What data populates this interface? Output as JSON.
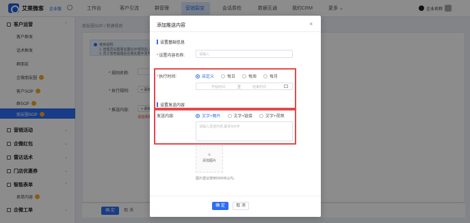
{
  "app": {
    "brand": "艾莱微客",
    "brand_sub": "企业版",
    "user_name": "企业名称"
  },
  "nav": [
    "工作台",
    "客户引流",
    "群管理",
    "营销裂变",
    "会话质检",
    "数据互通",
    "我的CRM",
    "更多 ⌄"
  ],
  "nav_active_index": 3,
  "sidebar": {
    "groups": [
      {
        "label": "客户运营",
        "items": [
          "客户群发",
          "话术群发",
          "群朋友",
          "企微朋友圈",
          "客户SOP",
          "群SOP",
          "朋友圈SOP"
        ]
      },
      {
        "label": "营销活动"
      },
      {
        "label": "企微红包"
      },
      {
        "label": "雷达话术"
      },
      {
        "label": "门店优惠券"
      },
      {
        "label": "智能表单",
        "items": [
          "表单内容"
        ]
      },
      {
        "label": "企微工单"
      }
    ],
    "active_item": "朋友圈SOP"
  },
  "main": {
    "breadcrumb": "朋友圈SOP / 新建规则",
    "tip_title": "使用说明:",
    "tip_lines": [
      "1. 管理员设置朋友圈SOP规则后,员工会收到推送提醒",
      "2. 员工收到提醒后在朋友圈中发布内容"
    ],
    "rule_name_label": "* 规则名称:",
    "rule_name_placeholder": "请输入",
    "exec_rule_label": "* 执行规则:",
    "add_label": "+ 添加",
    "push_content_label": "* 推送内容:",
    "push_add_label": "+ 添加",
    "red_hint": "请选择执行规则",
    "confirm": "确 定",
    "cancel": "取 消"
  },
  "modal": {
    "title": "添加推送内容",
    "close": "×",
    "section1": "设置基础信息",
    "content_name_label": "设置内容名称:",
    "content_name_placeholder": "请输入",
    "exec_time_label": "执行时间:",
    "exec_time_options": [
      "自定义",
      "每日",
      "每周",
      "每月"
    ],
    "exec_time_selected": 0,
    "start_date": "开始时间",
    "date_sep": "至",
    "end_date": "结束时间",
    "section2": "设置发送内容",
    "send_content_label": "发送内容:",
    "send_options": [
      "文字+图片",
      "文字+链接",
      "文字+视频"
    ],
    "send_selected": 0,
    "textarea_placeholder": "请输入发送内容,最多500字",
    "upload_plus": "+",
    "upload_label": "添加图片",
    "upload_hint": "图片建议使用500KB以内。",
    "confirm": "确 定",
    "cancel": "取 消"
  },
  "colors": {
    "primary": "#2c6ef2",
    "highlight": "#e5474a"
  }
}
